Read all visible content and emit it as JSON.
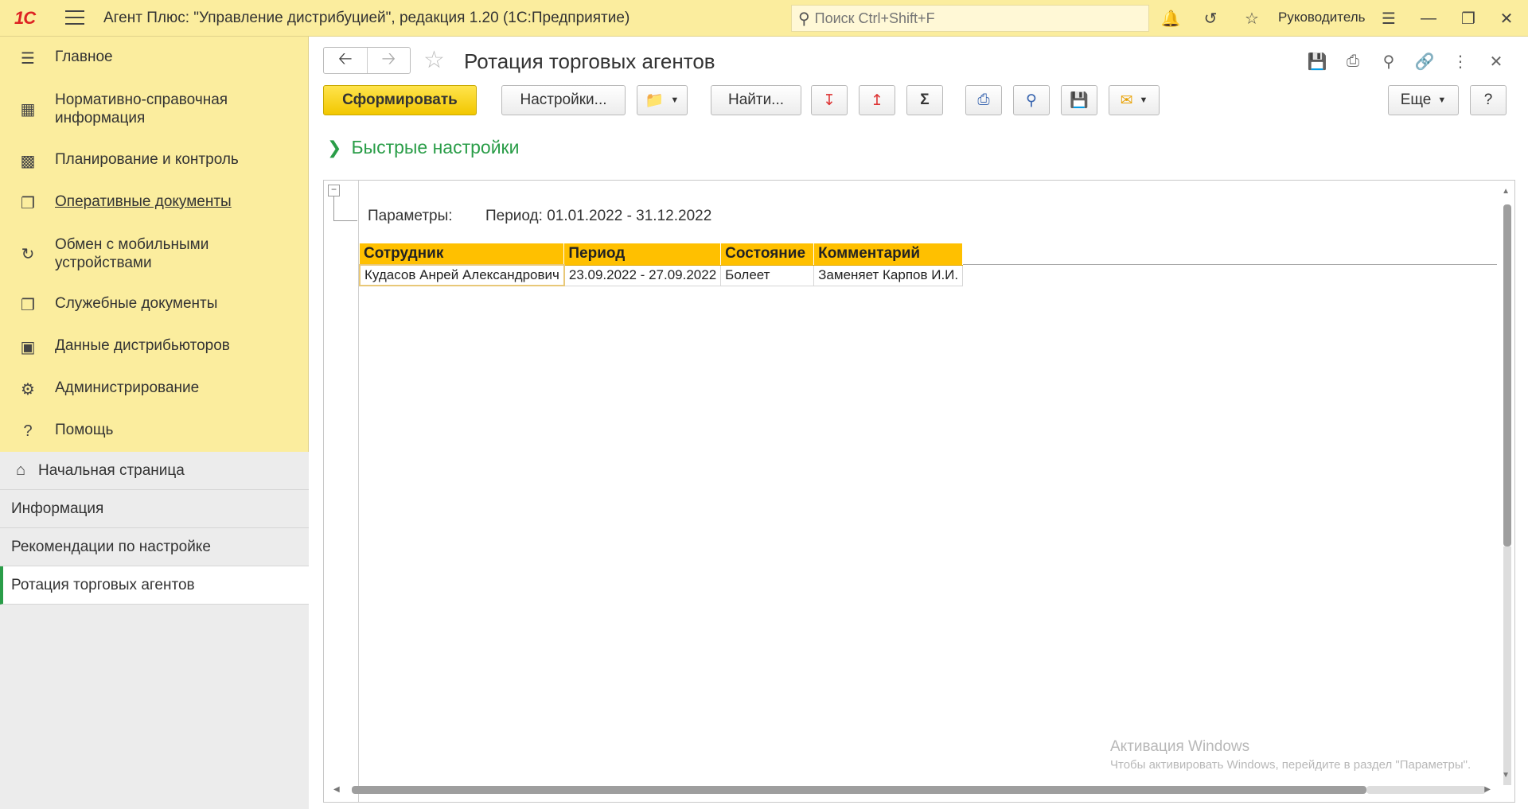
{
  "app": {
    "logo": "1С",
    "title": "Агент Плюс: \"Управление дистрибуцией\", редакция 1.20  (1С:Предприятие)",
    "search_placeholder": "Поиск Ctrl+Shift+F",
    "user": "Руководитель"
  },
  "sidebar": {
    "sections": [
      {
        "label": "Главное",
        "icon": "list-icon"
      },
      {
        "label": "Нормативно-справочная информация",
        "icon": "books-icon"
      },
      {
        "label": "Планирование и контроль",
        "icon": "chart-icon"
      },
      {
        "label": "Оперативные документы",
        "icon": "documents-icon"
      },
      {
        "label": "Обмен с мобильными устройствами",
        "icon": "sync-icon"
      },
      {
        "label": "Служебные документы",
        "icon": "service-docs-icon"
      },
      {
        "label": "Данные дистрибьюторов",
        "icon": "distributor-icon"
      },
      {
        "label": "Администрирование",
        "icon": "gear-icon"
      },
      {
        "label": "Помощь",
        "icon": "help-icon"
      }
    ],
    "open_windows": [
      {
        "label": "Начальная страница"
      },
      {
        "label": "Информация"
      },
      {
        "label": "Рекомендации по настройке"
      },
      {
        "label": "Ротация торговых агентов"
      }
    ]
  },
  "main": {
    "title": "Ротация торговых агентов",
    "toolbar": {
      "generate": "Сформировать",
      "settings": "Настройки...",
      "find": "Найти...",
      "more": "Еще",
      "help": "?"
    },
    "quick_settings": "Быстрые настройки",
    "report": {
      "params_label": "Параметры:",
      "params_value": "Период: 01.01.2022 - 31.12.2022",
      "columns": [
        "Сотрудник",
        "Период",
        "Состояние",
        "Комментарий"
      ],
      "rows": [
        [
          "Кудасов Анрей Александрович",
          "23.09.2022 - 27.09.2022",
          "Болеет",
          "Заменяет Карпов И.И."
        ]
      ]
    },
    "watermark": {
      "title": "Активация Windows",
      "text": "Чтобы активировать Windows, перейдите в раздел \"Параметры\"."
    }
  },
  "colors": {
    "accent_yellow": "#FBED9E",
    "header_orange": "#FFC000",
    "active_green": "#2a9d48"
  }
}
